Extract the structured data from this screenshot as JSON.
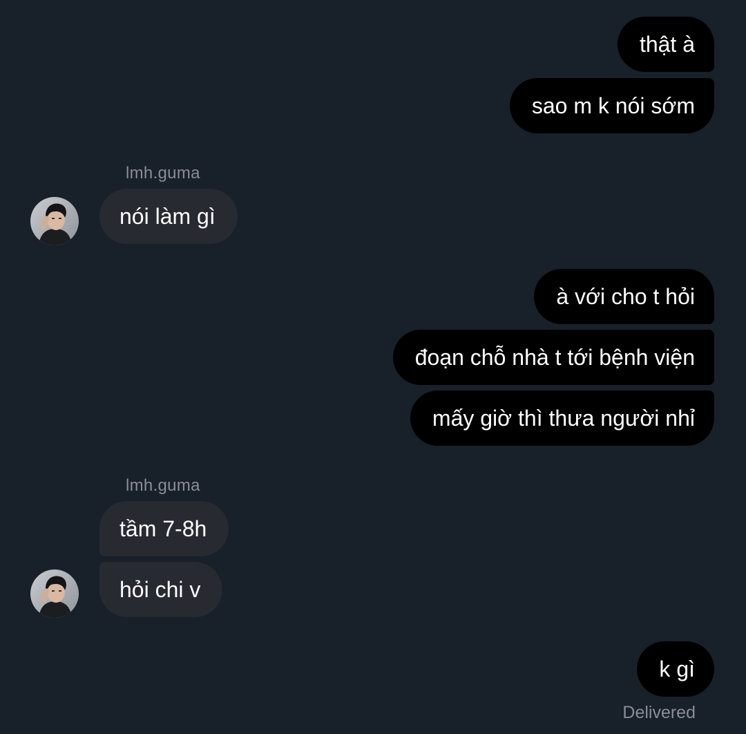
{
  "conversation": {
    "messages": [
      {
        "direction": "outgoing",
        "text": "thật à"
      },
      {
        "direction": "outgoing",
        "text": "sao m k nói sớm"
      },
      {
        "direction": "incoming",
        "sender": "lmh.guma",
        "text": "nói làm gì"
      },
      {
        "direction": "outgoing",
        "text": "à với cho t hỏi"
      },
      {
        "direction": "outgoing",
        "text": "đoạn chỗ nhà t tới bệnh viện"
      },
      {
        "direction": "outgoing",
        "text": "mấy giờ thì thưa người nhỉ"
      },
      {
        "direction": "incoming",
        "sender": "lmh.guma",
        "text": "tầm 7-8h"
      },
      {
        "direction": "incoming",
        "sender": "lmh.guma",
        "text": "hỏi chi v"
      },
      {
        "direction": "outgoing",
        "text": "k gì"
      }
    ],
    "sender_labels": [
      "lmh.guma",
      "lmh.guma"
    ],
    "status": "Delivered"
  },
  "avatar": {
    "icon": "profile-photo-avatar"
  },
  "colors": {
    "background": "#18202a",
    "outgoing_bubble": "#000000",
    "incoming_bubble": "#272a31",
    "text": "#ffffff",
    "muted_text": "#8a8e95"
  }
}
